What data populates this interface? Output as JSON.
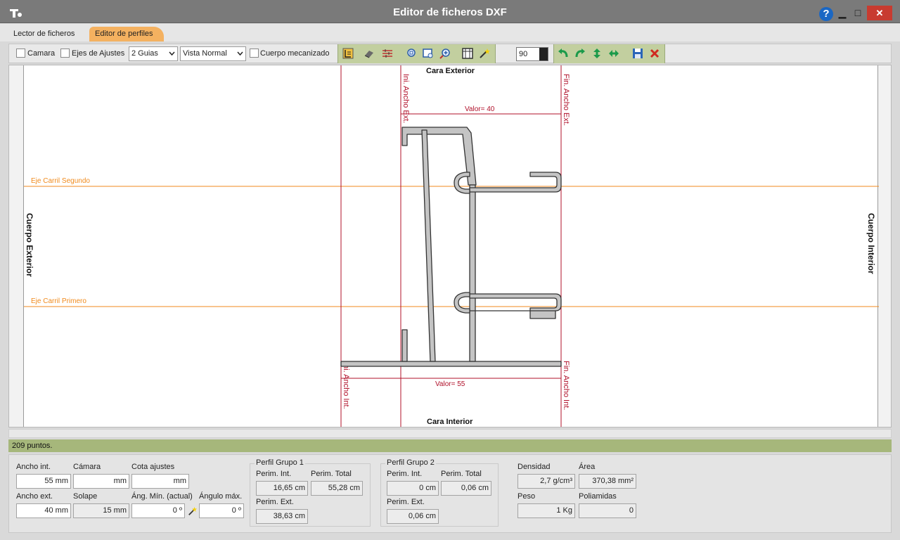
{
  "window": {
    "title": "Editor de ficheros DXF",
    "help": "?",
    "minimize": "▁",
    "maximize": "□",
    "close": "✕"
  },
  "tabs": [
    {
      "label": "Lector de ficheros",
      "active": false
    },
    {
      "label": "Editor de perfiles",
      "active": true
    }
  ],
  "toolbar": {
    "camara_label": "Camara",
    "ejes_label": "Ejes de Ajustes",
    "guias_value": "2 Guias",
    "vista_value": "Vista Normal",
    "cuerpo_mecanizado_label": "Cuerpo mecanizado",
    "zoom_value": "90"
  },
  "canvas": {
    "top_label": "Cara Exterior",
    "bottom_label": "Cara Interior",
    "left_label": "Cuerpo Exterior",
    "right_label": "Cuerpo Interior",
    "axis_second": "Eje Carril Segundo",
    "axis_first": "Eje Carril Primero",
    "ini_ancho_ext": "Ini. Ancho Ext.",
    "fin_ancho_ext": "Fin. Ancho Ext.",
    "ini_ancho_int": "Ini. Ancho Int.",
    "fin_ancho_int": "Fin. Ancho Int.",
    "valor_top": "Valor= 40",
    "valor_bottom": "Valor= 55"
  },
  "colors": {
    "dimension_line": "#b0102a",
    "axis_line": "#f08a1c",
    "profile_fill": "#c4c4c4",
    "status_bar": "#a6b77b",
    "toolbar_group": "#c2cf9f"
  },
  "status": {
    "text": "209 puntos."
  },
  "fields": {
    "ancho_int_label": "Ancho int.",
    "ancho_int_value": "55 mm",
    "camara_label": "Cámara",
    "camara_value": "mm",
    "cota_ajustes_label": "Cota ajustes",
    "cota_ajustes_value": "mm",
    "ancho_ext_label": "Ancho ext.",
    "ancho_ext_value": "40 mm",
    "solape_label": "Solape",
    "solape_value": "15 mm",
    "ang_min_label": "Áng. Mín. (actual)",
    "ang_min_value": "0 º",
    "angulo_max_label": "Ángulo máx.",
    "angulo_max_value": "0 º"
  },
  "grupo1": {
    "title": "Perfil Grupo 1",
    "perim_int_label": "Perim. Int.",
    "perim_int_value": "16,65 cm",
    "perim_total_label": "Perim. Total",
    "perim_total_value": "55,28 cm",
    "perim_ext_label": "Perim. Ext.",
    "perim_ext_value": "38,63 cm"
  },
  "grupo2": {
    "title": "Perfil Grupo 2",
    "perim_int_label": "Perim. Int.",
    "perim_int_value": "0 cm",
    "perim_total_label": "Perim. Total",
    "perim_total_value": "0,06 cm",
    "perim_ext_label": "Perim. Ext.",
    "perim_ext_value": "0,06 cm"
  },
  "props": {
    "densidad_label": "Densidad",
    "densidad_value": "2,7 g/cm³",
    "area_label": "Área",
    "area_value": "370,38 mm²",
    "peso_label": "Peso",
    "peso_value": "1 Kg",
    "poliamidas_label": "Poliamidas",
    "poliamidas_value": "0"
  }
}
